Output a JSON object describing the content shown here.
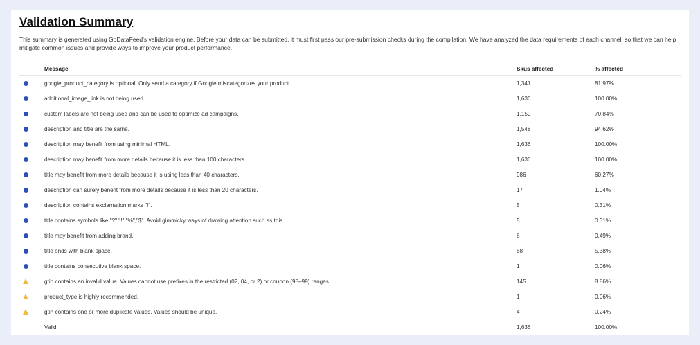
{
  "summary": {
    "title": "Validation Summary",
    "description": "This summary is generated using GoDataFeed's validation engine. Before your data can be submitted, it must first pass our pre-submission checks during the compilation. We have analyzed the data requirements of each channel, so that we can help mitigate common issues and provide ways to improve your product performance."
  },
  "table": {
    "headers": {
      "message": "Message",
      "skus": "Skus affected",
      "pct": "% affected"
    },
    "rows": [
      {
        "icon": "info-icon",
        "message": "google_product_category is optional. Only send a category if Google miscategorizes your product.",
        "skus": "1,341",
        "pct": "81.97%"
      },
      {
        "icon": "info-icon",
        "message": "additional_image_link is not being used.",
        "skus": "1,636",
        "pct": "100.00%"
      },
      {
        "icon": "info-icon",
        "message": "custom labels are not being used and can be used to optimize ad campaigns.",
        "skus": "1,159",
        "pct": "70.84%"
      },
      {
        "icon": "info-icon",
        "message": "description and title are the same.",
        "skus": "1,548",
        "pct": "94.62%"
      },
      {
        "icon": "info-icon",
        "message": "description may benefit from using minimal HTML.",
        "skus": "1,636",
        "pct": "100.00%"
      },
      {
        "icon": "info-icon",
        "message": "description may benefit from more details because it is less than 100 characters.",
        "skus": "1,636",
        "pct": "100.00%"
      },
      {
        "icon": "info-icon",
        "message": "title may benefit from more details because it is using less than 40 characters.",
        "skus": "986",
        "pct": "60.27%"
      },
      {
        "icon": "info-icon",
        "message": "description can surely benefit from more details because it is less than 20 characters.",
        "skus": "17",
        "pct": "1.04%"
      },
      {
        "icon": "info-icon",
        "message": "description contains exclamation marks \"!\".",
        "skus": "5",
        "pct": "0.31%"
      },
      {
        "icon": "info-icon",
        "message": "title contains symbols like \"?\",\"!\",\"%\",\"$\". Avoid gimmicky ways of drawing attention such as this.",
        "skus": "5",
        "pct": "0.31%"
      },
      {
        "icon": "info-icon",
        "message": "title may benefit from adding brand.",
        "skus": "8",
        "pct": "0.49%"
      },
      {
        "icon": "info-icon",
        "message": "title ends with blank space.",
        "skus": "88",
        "pct": "5.38%"
      },
      {
        "icon": "info-icon",
        "message": "title contains consecutive blank space.",
        "skus": "1",
        "pct": "0.06%"
      },
      {
        "icon": "warning-icon",
        "message": "gtin contains an invalid value. Values cannot use prefixes in the restricted (02, 04, or 2) or coupon (98–99) ranges.",
        "skus": "145",
        "pct": "8.86%"
      },
      {
        "icon": "warning-icon",
        "message": "product_type is highly recommended.",
        "skus": "1",
        "pct": "0.06%"
      },
      {
        "icon": "warning-icon",
        "message": "gtin contains one or more duplicate values. Values should be unique.",
        "skus": "4",
        "pct": "0.24%"
      },
      {
        "icon": "",
        "message": "Valid",
        "skus": "1,636",
        "pct": "100.00%"
      }
    ]
  },
  "colors": {
    "page_background": "#e9eef9",
    "info_icon": "#2f4fb8",
    "warning_icon": "#f3b93a"
  }
}
